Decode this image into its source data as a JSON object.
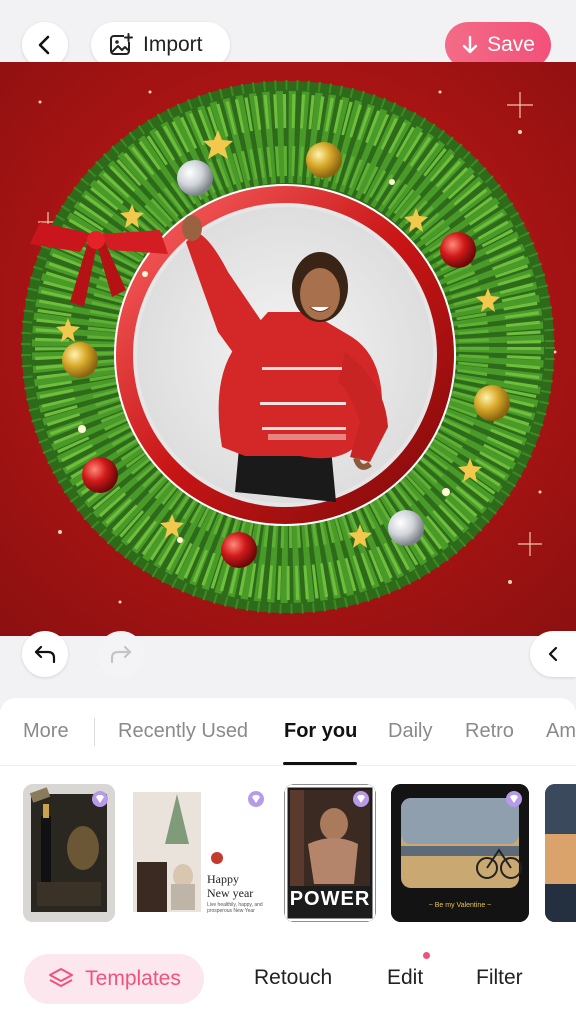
{
  "toolbar": {
    "import_label": "Import",
    "save_label": "Save"
  },
  "tabs": [
    {
      "label": "More"
    },
    {
      "label": "Recently Used"
    },
    {
      "label": "For you",
      "active": true
    },
    {
      "label": "Daily"
    },
    {
      "label": "Retro"
    },
    {
      "label": "Am"
    }
  ],
  "templates": [
    {
      "name": "champagne",
      "premium": true
    },
    {
      "name": "happy-new-year",
      "text1": "Happy",
      "text2": "New year",
      "small": "Live healthily, happy, and prosperous New Year",
      "premium": true
    },
    {
      "name": "power",
      "text": "POWER",
      "premium": true
    },
    {
      "name": "valentine",
      "text": "~ Be my Valentine ~",
      "premium": true
    },
    {
      "name": "partial",
      "premium": false
    }
  ],
  "nav": {
    "templates": "Templates",
    "retouch": "Retouch",
    "edit": "Edit",
    "filter": "Filter"
  },
  "colors": {
    "accent": "#f2517a",
    "canvas_bg": "#b51717"
  }
}
